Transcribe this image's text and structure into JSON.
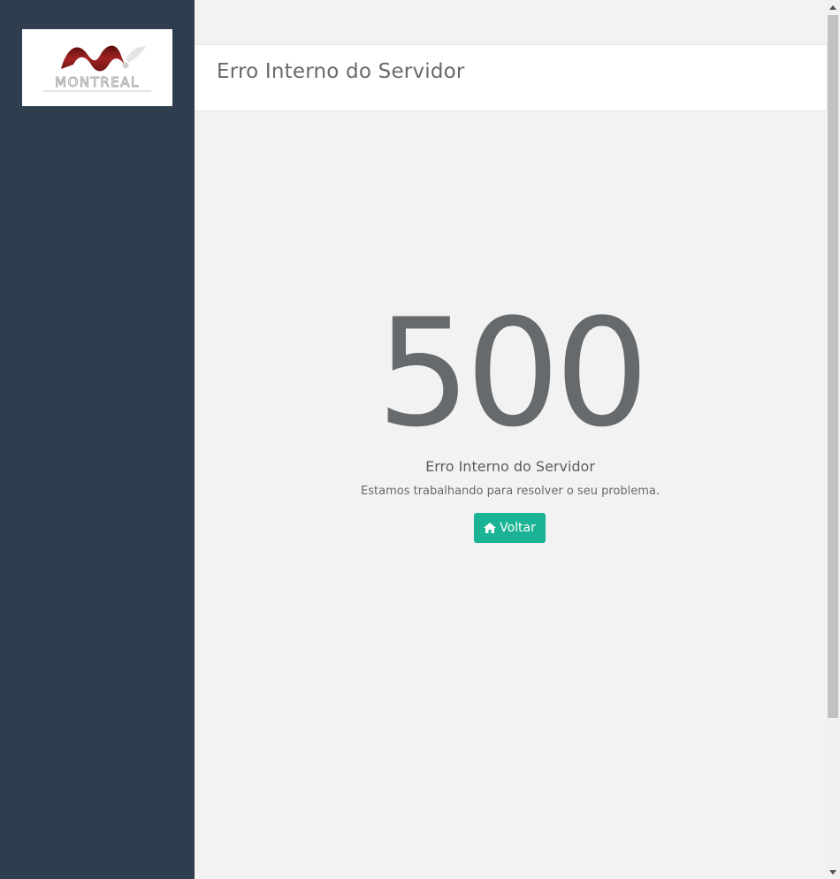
{
  "sidebar": {
    "logo": {
      "text": "MONTREAL",
      "icon": "montreal-logo-icon",
      "colors": {
        "mark": "#8b1a1a",
        "text": "#b0b0b0"
      }
    }
  },
  "header": {
    "title": "Erro Interno do Servidor"
  },
  "error": {
    "code": "500",
    "heading": "Erro Interno do Servidor",
    "description": "Estamos trabalhando para resolver o seu problema.",
    "back_button": {
      "label": "Voltar",
      "icon": "home-icon"
    }
  },
  "colors": {
    "sidebar_bg": "#2e3e4e",
    "page_bg": "#f2f2f2",
    "accent": "#1ab394",
    "text": "#676a6c"
  }
}
